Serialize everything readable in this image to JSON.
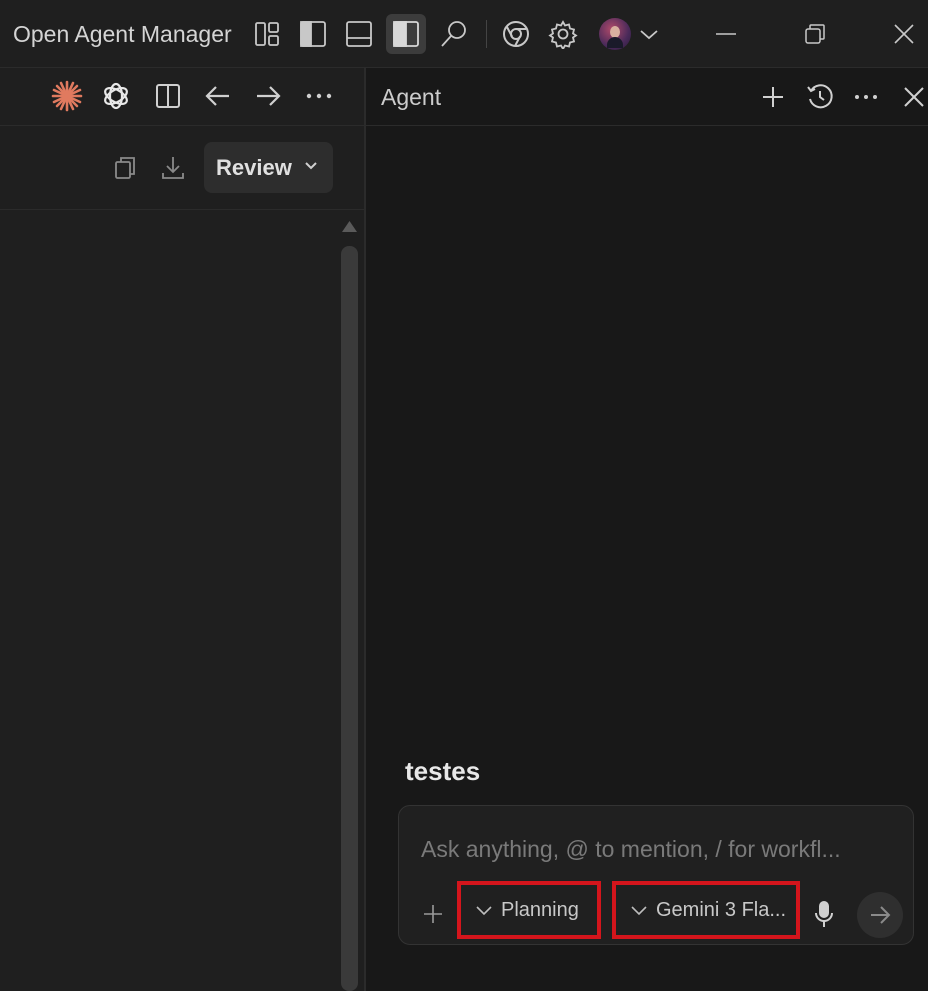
{
  "app": {
    "title": "Open Agent Manager"
  },
  "left_pane": {
    "review_label": "Review"
  },
  "agent": {
    "title": "Agent",
    "conversation_title": "testes",
    "input_placeholder": "Ask anything, @ to mention, / for workfl...",
    "mode_label": "Planning",
    "model_label": "Gemini 3 Fla..."
  },
  "colors": {
    "highlight": "#d4151c",
    "accent_orange": "#e07a5f",
    "background": "#181818"
  },
  "icons": {
    "titlebar": [
      "layout-grid-icon",
      "sidebar-left-icon",
      "panel-bottom-icon",
      "sidebar-right-icon",
      "search-icon",
      "chrome-icon",
      "gear-icon",
      "avatar",
      "chevron-down-icon",
      "minimize-icon",
      "restore-icon",
      "close-icon"
    ],
    "left_toolbar": [
      "claude-icon",
      "openai-icon",
      "split-view-icon",
      "arrow-left-icon",
      "arrow-right-icon",
      "more-icon"
    ],
    "agent_header": [
      "plus-icon",
      "history-icon",
      "more-icon",
      "close-icon"
    ]
  }
}
